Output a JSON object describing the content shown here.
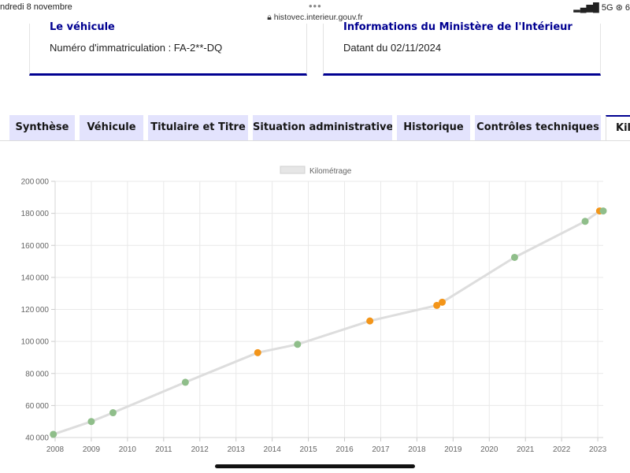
{
  "status_bar": {
    "date": "ndredi 8 novembre",
    "url": "histovec.interieur.gouv.fr",
    "network": "5G",
    "battery": "6"
  },
  "cards": [
    {
      "title": "Le véhicule",
      "text": "Numéro d'immatriculation : FA-2**-DQ"
    },
    {
      "title": "Informations du Ministère de l'Intérieur",
      "text": "Datant du 02/11/2024"
    }
  ],
  "tabs": [
    {
      "label": "Synthèse"
    },
    {
      "label": "Véhicule"
    },
    {
      "label": "Titulaire et Titre"
    },
    {
      "label": "Situation administrative"
    },
    {
      "label": "Historique"
    },
    {
      "label": "Contrôles techniques"
    },
    {
      "label": "Kilo",
      "active": true
    }
  ],
  "colors": {
    "accent": "#000091",
    "tab_bg": "#e3e3fd",
    "point_green": "#8fbe8a",
    "point_orange": "#f39519",
    "line": "#dddddd"
  },
  "chart_data": {
    "type": "line",
    "legend": "Kilométrage",
    "legend_position": "top",
    "grid": true,
    "xlim": [
      2008,
      2023.15
    ],
    "ylim": [
      40000,
      200000
    ],
    "x_ticks": [
      "2008",
      "2009",
      "2010",
      "2011",
      "2012",
      "2013",
      "2014",
      "2015",
      "2016",
      "2017",
      "2018",
      "2019",
      "2020",
      "2021",
      "2022",
      "2023"
    ],
    "y_ticks": [
      "40000",
      "60000",
      "80000",
      "100000",
      "120000",
      "140000",
      "160000",
      "180000",
      "200000"
    ],
    "points": [
      {
        "x": 2007.95,
        "y": 42000,
        "category": "green"
      },
      {
        "x": 2009.0,
        "y": 50000,
        "category": "green"
      },
      {
        "x": 2009.6,
        "y": 55500,
        "category": "green"
      },
      {
        "x": 2011.6,
        "y": 74500,
        "category": "green"
      },
      {
        "x": 2013.6,
        "y": 93000,
        "category": "orange"
      },
      {
        "x": 2014.7,
        "y": 98200,
        "category": "green"
      },
      {
        "x": 2016.7,
        "y": 112800,
        "category": "orange"
      },
      {
        "x": 2018.55,
        "y": 122500,
        "category": "orange"
      },
      {
        "x": 2018.7,
        "y": 124500,
        "category": "orange"
      },
      {
        "x": 2020.7,
        "y": 152500,
        "category": "green"
      },
      {
        "x": 2022.65,
        "y": 175000,
        "category": "green"
      },
      {
        "x": 2023.05,
        "y": 181500,
        "category": "orange"
      },
      {
        "x": 2023.15,
        "y": 181500,
        "category": "green"
      }
    ]
  }
}
